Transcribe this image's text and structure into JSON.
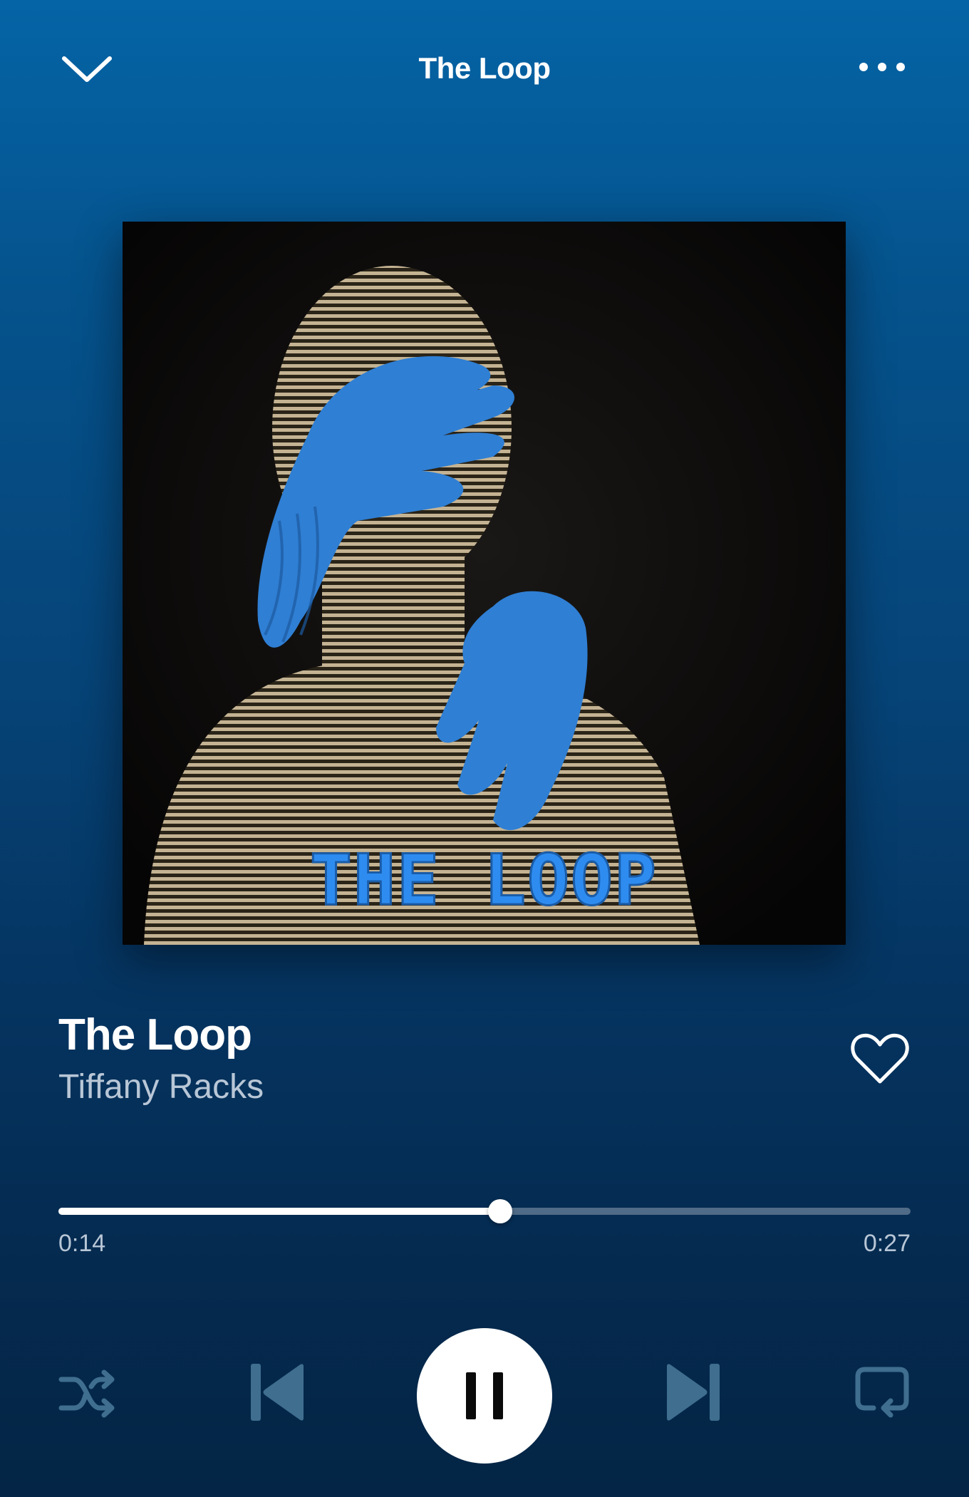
{
  "header": {
    "title": "The Loop",
    "collapse_icon": "chevron-down-icon",
    "more_icon": "more-horizontal-icon"
  },
  "cover": {
    "overlay_text": "THE LOOP",
    "colors": {
      "background": "#0b0a0a",
      "figure": "#b8a888",
      "hands": "#2f7fd4",
      "text": "#2e8cf0"
    }
  },
  "track": {
    "title": "The Loop",
    "artist": "Tiffany Racks",
    "liked": false
  },
  "progress": {
    "elapsed": "0:14",
    "total": "0:27",
    "fraction": 0.518
  },
  "controls": {
    "shuffle_icon": "shuffle-icon",
    "previous_icon": "skip-previous-icon",
    "play_state": "playing",
    "pause_icon": "pause-icon",
    "next_icon": "skip-next-icon",
    "repeat_icon": "repeat-icon"
  },
  "colors": {
    "background_top": "#0564a6",
    "background_bottom": "#042545",
    "muted_control": "#3f6e8f",
    "secondary_text": "#b8c6d6"
  }
}
